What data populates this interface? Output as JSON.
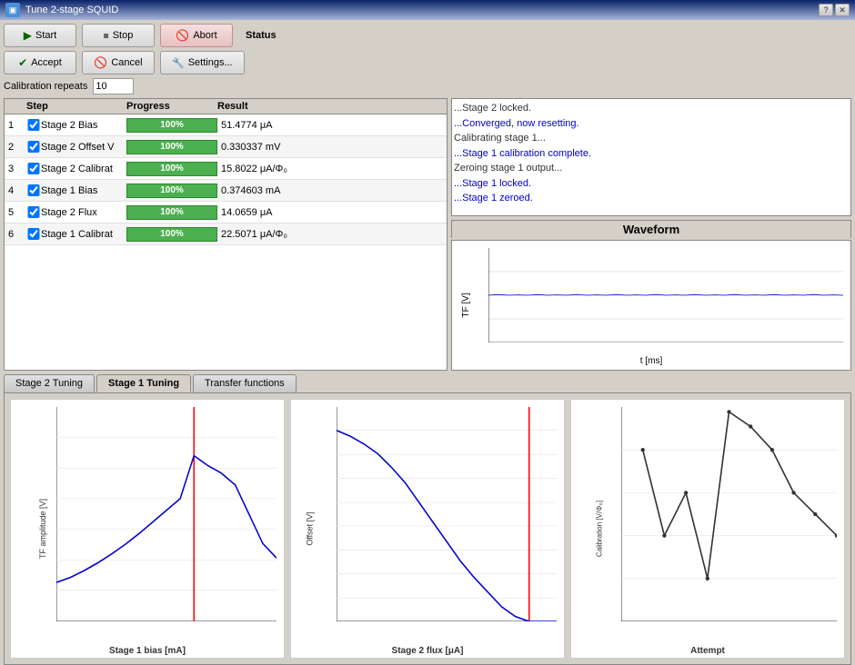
{
  "window": {
    "title": "Tune 2-stage SQUID"
  },
  "toolbar": {
    "start_label": "Start",
    "stop_label": "Stop",
    "abort_label": "Abort",
    "accept_label": "Accept",
    "cancel_label": "Cancel",
    "settings_label": "Settings..."
  },
  "calibration": {
    "label": "Calibration repeats",
    "value": "10"
  },
  "status": {
    "label": "Status",
    "items": [
      {
        "text": "...Stage 2 locked.",
        "style": "normal"
      },
      {
        "text": "...Converged, now resetting.",
        "style": "blue"
      },
      {
        "text": "Calibrating stage 1...",
        "style": "normal"
      },
      {
        "text": "...Stage 1 calibration complete.",
        "style": "blue"
      },
      {
        "text": "Zeroing stage 1 output...",
        "style": "normal"
      },
      {
        "text": "...Stage 1 locked.",
        "style": "blue"
      },
      {
        "text": "...Stage 1 zeroed.",
        "style": "blue"
      }
    ]
  },
  "waveform": {
    "title": "Waveform",
    "y_label": "TF [V]",
    "x_label": "t [ms]",
    "y_min": -4,
    "y_max": 4,
    "x_min": 0,
    "x_max": 200,
    "x_ticks": [
      0,
      50,
      100,
      150,
      200
    ],
    "y_ticks": [
      -4,
      -2,
      0,
      2,
      4
    ]
  },
  "table": {
    "headers": [
      "Step",
      "Progress",
      "Result"
    ],
    "rows": [
      {
        "num": 1,
        "checked": true,
        "step": "Stage 2 Bias",
        "progress": 100,
        "result": "51.4774 μA"
      },
      {
        "num": 2,
        "checked": true,
        "step": "Stage 2 Offset V",
        "progress": 100,
        "result": "0.330337 mV"
      },
      {
        "num": 3,
        "checked": true,
        "step": "Stage 2 Calibrat",
        "progress": 100,
        "result": "15.8022 μA/Φ₀"
      },
      {
        "num": 4,
        "checked": true,
        "step": "Stage 1 Bias",
        "progress": 100,
        "result": "0.374603 mA"
      },
      {
        "num": 5,
        "checked": true,
        "step": "Stage 2 Flux",
        "progress": 100,
        "result": "14.0659 μA"
      },
      {
        "num": 6,
        "checked": true,
        "step": "Stage 1 Calibrat",
        "progress": 100,
        "result": "22.5071 μA/Φ₀"
      }
    ]
  },
  "tabs": {
    "items": [
      "Stage 2 Tuning",
      "Stage 1 Tuning",
      "Transfer functions"
    ],
    "active": 1
  },
  "chart1": {
    "title": "",
    "y_label": "TF amplitude [V]",
    "x_label": "Stage 1 bias [mA]",
    "y_min": 0.75,
    "y_max": 1.1,
    "x_min": 0.1,
    "x_max": 0.5,
    "red_line_x": 0.35,
    "x_ticks": [
      "0.1",
      "0.15",
      "0.2",
      "0.25",
      "0.3",
      "0.35",
      "0.4",
      "0.45",
      "0.5"
    ],
    "y_ticks": [
      "0.75",
      "0.8",
      "0.85",
      "0.9",
      "0.95",
      "1",
      "1.05",
      "1.1"
    ]
  },
  "chart2": {
    "title": "",
    "y_label": "Offset [V]",
    "x_label": "Stage 2 flux [μA]",
    "y_min": -1.6,
    "y_max": 0.2,
    "x_min": 0,
    "x_max": 16,
    "red_line_x": 14,
    "x_ticks": [
      "0",
      "2",
      "4",
      "6",
      "8",
      "10",
      "12",
      "14",
      "16"
    ],
    "y_ticks": [
      "-1.6",
      "-1.4",
      "-1.2",
      "-1.0",
      "-0.8",
      "-0.6",
      "-0.4",
      "-0.2",
      "0.0",
      "0.2"
    ]
  },
  "chart3": {
    "title": "",
    "y_label": "Calibration [V/Φ₀]",
    "x_label": "Attempt",
    "y_min": 2.2504,
    "y_max": 2.2509,
    "x_min": 0,
    "x_max": 10,
    "x_ticks": [
      "0",
      "2",
      "4",
      "6",
      "8",
      "10"
    ],
    "y_ticks": [
      "2.2504",
      "2.2505",
      "2.2506",
      "2.2507",
      "2.2508",
      "2.2509"
    ]
  }
}
